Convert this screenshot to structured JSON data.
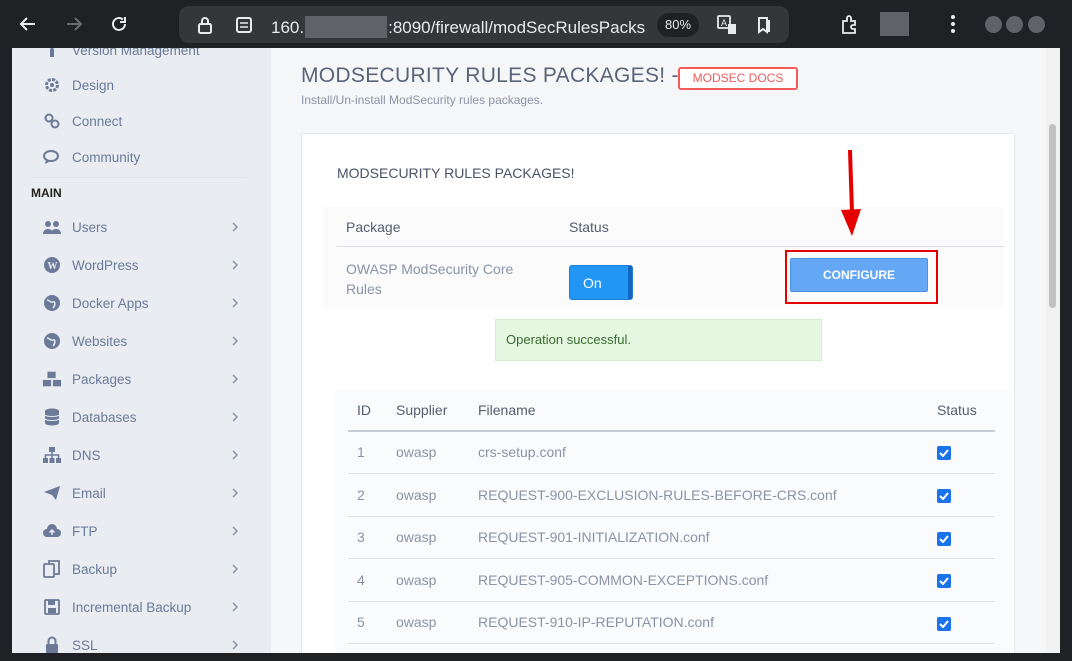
{
  "browser": {
    "url_prefix": "160.",
    "url_suffix": ":8090/firewall/modSecRulesPacks",
    "zoom": "80%"
  },
  "sidebar": {
    "items_top": [
      {
        "label": "Version Management",
        "icon": "version-icon"
      },
      {
        "label": "Design",
        "icon": "gear-icon"
      },
      {
        "label": "Connect",
        "icon": "link-icon"
      },
      {
        "label": "Community",
        "icon": "chat-icon"
      }
    ],
    "section_heading": "MAIN",
    "items_main": [
      {
        "label": "Users",
        "icon": "users-icon"
      },
      {
        "label": "WordPress",
        "icon": "wordpress-icon"
      },
      {
        "label": "Docker Apps",
        "icon": "globe-icon"
      },
      {
        "label": "Websites",
        "icon": "globe-icon"
      },
      {
        "label": "Packages",
        "icon": "cubes-icon"
      },
      {
        "label": "Databases",
        "icon": "database-icon"
      },
      {
        "label": "DNS",
        "icon": "sitemap-icon"
      },
      {
        "label": "Email",
        "icon": "paper-plane-icon"
      },
      {
        "label": "FTP",
        "icon": "cloud-upload-icon"
      },
      {
        "label": "Backup",
        "icon": "copy-icon"
      },
      {
        "label": "Incremental Backup",
        "icon": "save-icon"
      },
      {
        "label": "SSL",
        "icon": "lock-icon"
      }
    ]
  },
  "main": {
    "title": "MODSECURITY RULES PACKAGES! -",
    "docs_button": "MODSEC DOCS",
    "subtitle": "Install/Un-install ModSecurity rules packages.",
    "card_title": "MODSECURITY RULES PACKAGES!",
    "package_table": {
      "headers": [
        "Package",
        "Status"
      ],
      "row": {
        "package": "OWASP ModSecurity Core Rules",
        "status": "On",
        "button": "CONFIGURE"
      }
    },
    "alert": "Operation successful.",
    "rules_table": {
      "headers": [
        "ID",
        "Supplier",
        "Filename",
        "Status"
      ],
      "rows": [
        {
          "id": "1",
          "supplier": "owasp",
          "filename": "crs-setup.conf",
          "checked": true
        },
        {
          "id": "2",
          "supplier": "owasp",
          "filename": "REQUEST-900-EXCLUSION-RULES-BEFORE-CRS.conf",
          "checked": true
        },
        {
          "id": "3",
          "supplier": "owasp",
          "filename": "REQUEST-901-INITIALIZATION.conf",
          "checked": true
        },
        {
          "id": "4",
          "supplier": "owasp",
          "filename": "REQUEST-905-COMMON-EXCEPTIONS.conf",
          "checked": true
        },
        {
          "id": "5",
          "supplier": "owasp",
          "filename": "REQUEST-910-IP-REPUTATION.conf",
          "checked": true
        }
      ]
    }
  },
  "colors": {
    "accent": "#2196f3",
    "annotation_red": "#e50000",
    "sidebar_bg": "#e9ecf1"
  }
}
